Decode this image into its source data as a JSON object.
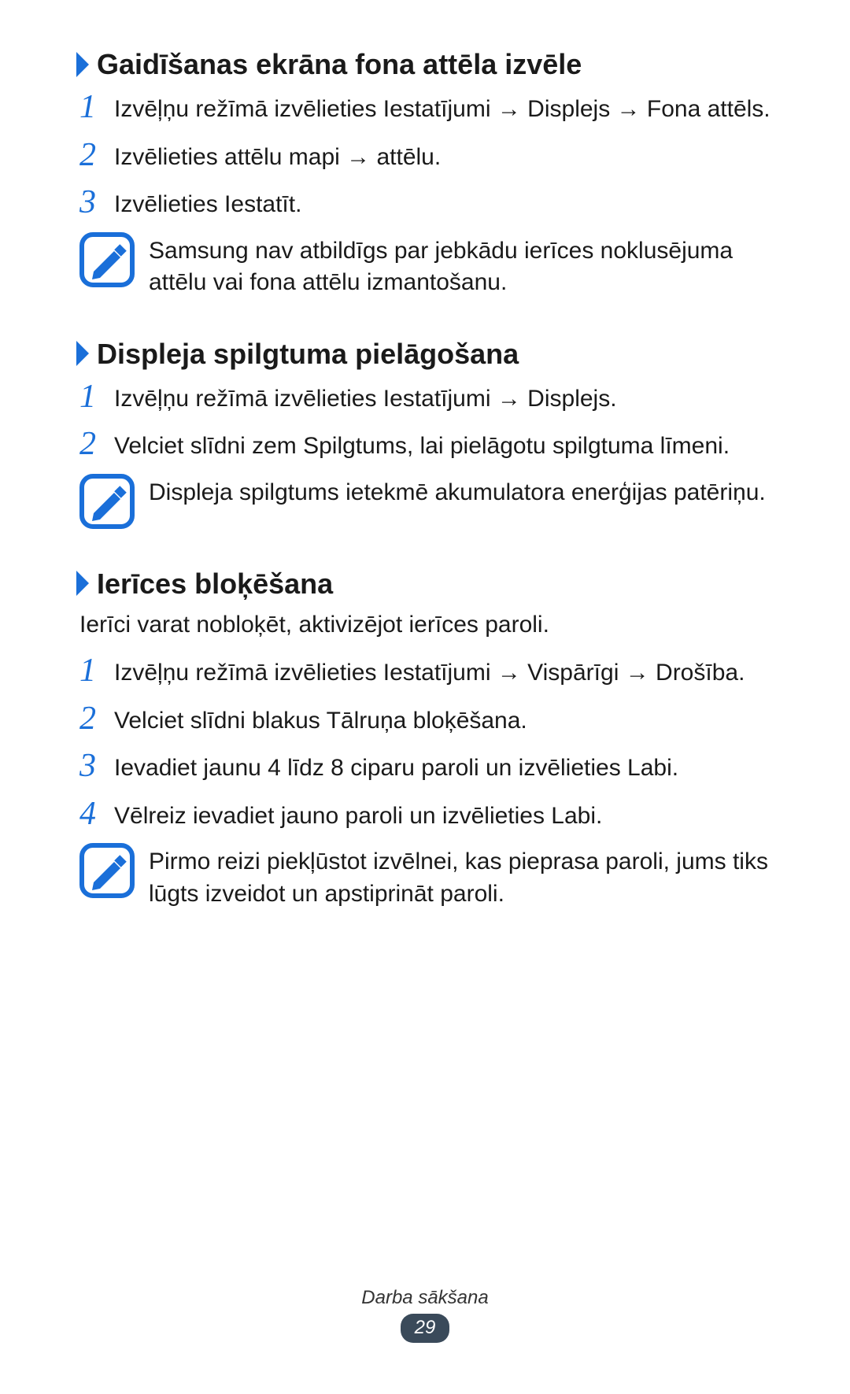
{
  "sections": [
    {
      "heading": "Gaidīšanas ekrāna fona attēla izvēle",
      "intro": "",
      "steps": [
        {
          "num": "1",
          "text": "Izvēļņu režīmā izvēlieties Iestatījumi → Displejs → Fona attēls."
        },
        {
          "num": "2",
          "text": "Izvēlieties attēlu mapi → attēlu."
        },
        {
          "num": "3",
          "text": "Izvēlieties Iestatīt."
        }
      ],
      "note": "Samsung nav atbildīgs par jebkādu ierīces noklusējuma attēlu vai fona attēlu izmantošanu."
    },
    {
      "heading": "Displeja spilgtuma pielāgošana",
      "intro": "",
      "steps": [
        {
          "num": "1",
          "text": "Izvēļņu režīmā izvēlieties Iestatījumi → Displejs."
        },
        {
          "num": "2",
          "text": "Velciet slīdni zem Spilgtums, lai pielāgotu spilgtuma līmeni."
        }
      ],
      "note": "Displeja spilgtums ietekmē akumulatora enerģijas patēriņu."
    },
    {
      "heading": "Ierīces bloķēšana",
      "intro": "Ierīci varat nobloķēt, aktivizējot ierīces paroli.",
      "steps": [
        {
          "num": "1",
          "text": "Izvēļņu režīmā izvēlieties Iestatījumi → Vispārīgi → Drošība."
        },
        {
          "num": "2",
          "text": "Velciet slīdni blakus Tālruņa bloķēšana."
        },
        {
          "num": "3",
          "text": "Ievadiet jaunu 4 līdz 8 ciparu paroli un izvēlieties Labi."
        },
        {
          "num": "4",
          "text": "Vēlreiz ievadiet jauno paroli un izvēlieties Labi."
        }
      ],
      "note": "Pirmo reizi piekļūstot izvēlnei, kas pieprasa paroli, jums tiks lūgts izveidot un apstiprināt paroli."
    }
  ],
  "footer": {
    "chapter": "Darba sākšana",
    "page": "29"
  },
  "colors": {
    "accent": "#1a6fd9",
    "badge": "#3a4a5a"
  }
}
